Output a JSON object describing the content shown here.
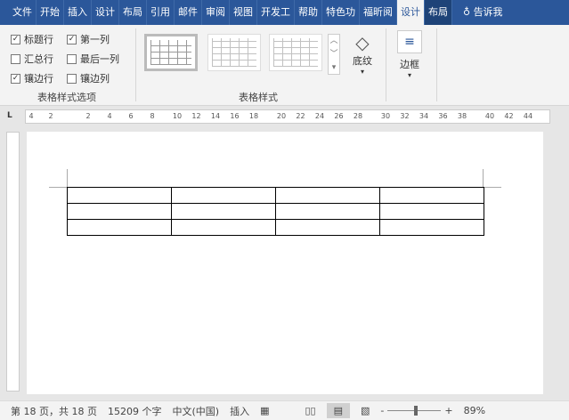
{
  "tabs": [
    "文件",
    "开始",
    "插入",
    "设计",
    "布局",
    "引用",
    "邮件",
    "审阅",
    "视图",
    "开发工",
    "帮助",
    "特色功",
    "福昕阅",
    "设计",
    "布局"
  ],
  "tell_me": "告诉我",
  "options": {
    "header_row": {
      "label": "标题行",
      "checked": true
    },
    "first_column": {
      "label": "第一列",
      "checked": true
    },
    "total_row": {
      "label": "汇总行",
      "checked": false
    },
    "last_column": {
      "label": "最后一列",
      "checked": false
    },
    "banded_rows": {
      "label": "镶边行",
      "checked": true
    },
    "banded_columns": {
      "label": "镶边列",
      "checked": false
    },
    "group_label": "表格样式选项"
  },
  "styles": {
    "group_label": "表格样式",
    "shading": "底纹",
    "borders": "边框"
  },
  "ruler": [
    "4",
    "2",
    "2",
    "4",
    "6",
    "8",
    "10",
    "12",
    "14",
    "16",
    "18",
    "20",
    "22",
    "24",
    "26",
    "28",
    "30",
    "32",
    "34",
    "36",
    "38",
    "40",
    "42",
    "44"
  ],
  "status": {
    "page": "第 18 页，共 18 页",
    "words": "15209 个字",
    "language": "中文(中国)",
    "mode": "插入",
    "zoom": "89%",
    "zoom_minus": "-",
    "zoom_plus": "+"
  }
}
